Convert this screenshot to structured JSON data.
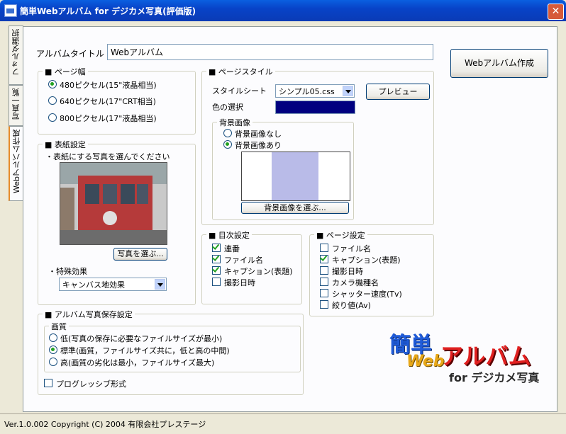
{
  "window": {
    "title": "簡単Webアルバム for デジカメ写真(評価版)",
    "close_glyph": "✕"
  },
  "side_tabs": [
    "フォルダ選択",
    "写真一覧",
    "Webアルバム作成"
  ],
  "album_title": {
    "label": "アルバムタイトル",
    "value": "Webアルバム"
  },
  "create_button": "Webアルバム作成",
  "page_width": {
    "title": "■ ページ幅",
    "options": [
      "480ピクセル(15\"液晶相当)",
      "640ピクセル(17\"CRT相当)",
      "800ピクセル(17\"液晶相当)"
    ],
    "selected": 0
  },
  "cover": {
    "title": "■ 表紙設定",
    "instruction": "・表紙にする写真を選んでください",
    "select_photo": "写真を選ぶ...",
    "effect_label": "・特殊効果",
    "effect_value": "キャンバス地効果"
  },
  "page_style": {
    "title": "■ ページスタイル",
    "stylesheet_label": "スタイルシート",
    "stylesheet_value": "シンプル05.css",
    "preview": "プレビュー",
    "color_label": "色の選択",
    "color_value": "#000080",
    "bg_title": "背景画像",
    "bg_options": [
      "背景画像なし",
      "背景画像あり"
    ],
    "bg_selected": 1,
    "bg_button": "背景画像を選ぶ..."
  },
  "toc": {
    "title": "■ 目次設定",
    "items": [
      {
        "label": "連番",
        "checked": true
      },
      {
        "label": "ファイル名",
        "checked": true
      },
      {
        "label": "キャプション(表題)",
        "checked": true
      },
      {
        "label": "撮影日時",
        "checked": false
      }
    ]
  },
  "page_settings": {
    "title": "■ ページ設定",
    "items": [
      {
        "label": "ファイル名",
        "checked": false
      },
      {
        "label": "キャプション(表題)",
        "checked": true
      },
      {
        "label": "撮影日時",
        "checked": false
      },
      {
        "label": "カメラ機種名",
        "checked": false
      },
      {
        "label": "シャッター速度(Tv)",
        "checked": false
      },
      {
        "label": "絞り値(Av)",
        "checked": false
      }
    ]
  },
  "save_settings": {
    "title": "■ アルバム写真保存設定",
    "quality_title": "画質",
    "options": [
      "低(写真の保存に必要なファイルサイズが最小)",
      "標準(画質，ファイルサイズ共に，低と高の中間)",
      "高(画質の劣化は最小，ファイルサイズ最大)"
    ],
    "selected": 1,
    "progressive": "プログレッシブ形式",
    "progressive_checked": false
  },
  "logo": {
    "line1": "簡単",
    "line2": "Web",
    "line3": "アルバム",
    "line4": "for デジカメ写真"
  },
  "status": "Ver.1.0.002 Copyright (C) 2004 有限会社プレステージ"
}
